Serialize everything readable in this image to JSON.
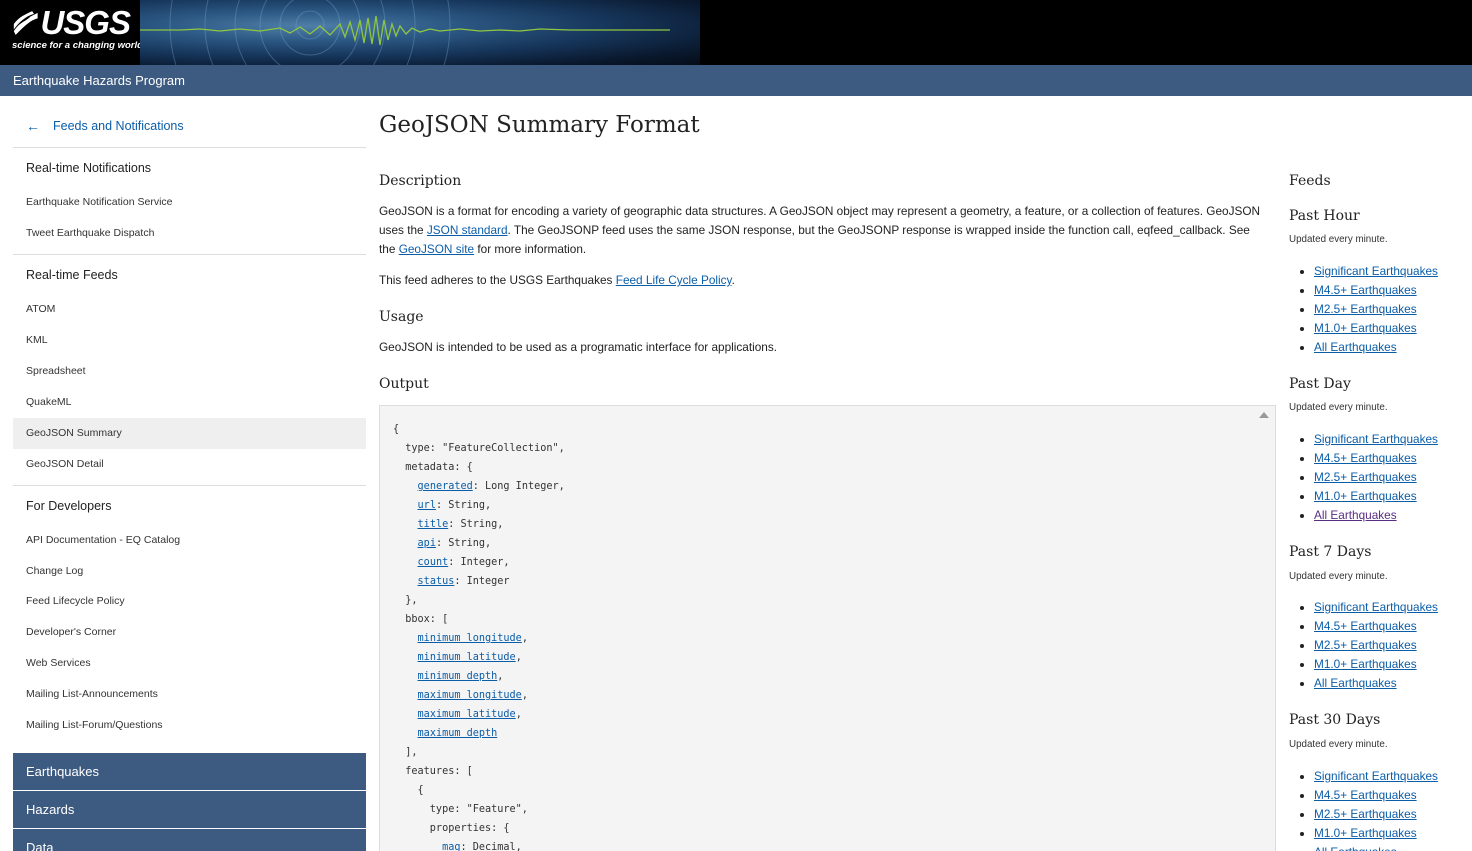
{
  "header": {
    "logo_text": "USGS",
    "logo_tagline": "science for a changing world",
    "program": "Earthquake Hazards Program"
  },
  "leftnav": {
    "back_label": "Feeds and Notifications",
    "sections": [
      {
        "heading": "Real-time Notifications",
        "items": [
          "Earthquake Notification Service",
          "Tweet Earthquake Dispatch"
        ]
      },
      {
        "heading": "Real-time Feeds",
        "items": [
          "ATOM",
          "KML",
          "Spreadsheet",
          "QuakeML",
          "GeoJSON Summary",
          "GeoJSON Detail"
        ]
      },
      {
        "heading": "For Developers",
        "items": [
          "API Documentation - EQ Catalog",
          "Change Log",
          "Feed Lifecycle Policy",
          "Developer's Corner",
          "Web Services",
          "Mailing List-Announcements",
          "Mailing List-Forum/Questions"
        ]
      }
    ],
    "active_item": "GeoJSON Summary",
    "big_items": [
      "Earthquakes",
      "Hazards",
      "Data"
    ]
  },
  "main": {
    "title": "GeoJSON Summary Format",
    "description_heading": "Description",
    "desc_1": "GeoJSON is a format for encoding a variety of geographic data structures. A GeoJSON object may represent a geometry, a feature, or a collection of features. GeoJSON uses the ",
    "desc_link_json": "JSON standard",
    "desc_2": ". The GeoJSONP feed uses the same JSON response, but the GeoJSONP response is wrapped inside the function call, eqfeed_callback. See the ",
    "desc_link_site": "GeoJSON site",
    "desc_3": " for more information.",
    "policy_1": "This feed adheres to the USGS Earthquakes ",
    "policy_link": "Feed Life Cycle Policy",
    "policy_2": ".",
    "usage_heading": "Usage",
    "usage_text": "GeoJSON is intended to be used as a programatic interface for applications.",
    "output_heading": "Output",
    "code": {
      "open": "{",
      "type_line": "  type: \"FeatureCollection\",",
      "metadata_open": "  metadata: {",
      "fields": [
        {
          "name": "generated",
          "rest": ": Long Integer,"
        },
        {
          "name": "url",
          "rest": ": String,"
        },
        {
          "name": "title",
          "rest": ": String,"
        },
        {
          "name": "api",
          "rest": ": String,"
        },
        {
          "name": "count",
          "rest": ": Integer,"
        },
        {
          "name": "status",
          "rest": ": Integer"
        }
      ],
      "metadata_close": "  },",
      "bbox_open": "  bbox: [",
      "bbox": [
        "minimum longitude",
        "minimum latitude",
        "minimum depth",
        "maximum longitude",
        "maximum latitude",
        "maximum depth"
      ],
      "bbox_close": "  ],",
      "features_open": "  features: [",
      "brace": "    {",
      "feature_type": "      type: \"Feature\",",
      "properties_open": "      properties: {",
      "mag_name": "mag",
      "mag_rest": ": Decimal,"
    }
  },
  "feeds": {
    "heading": "Feeds",
    "updated": "Updated every minute.",
    "groups": [
      "Past Hour",
      "Past Day",
      "Past 7 Days",
      "Past 30 Days"
    ],
    "links": [
      "Significant Earthquakes",
      "M4.5+ Earthquakes",
      "M2.5+ Earthquakes",
      "M1.0+ Earthquakes",
      "All Earthquakes"
    ]
  }
}
